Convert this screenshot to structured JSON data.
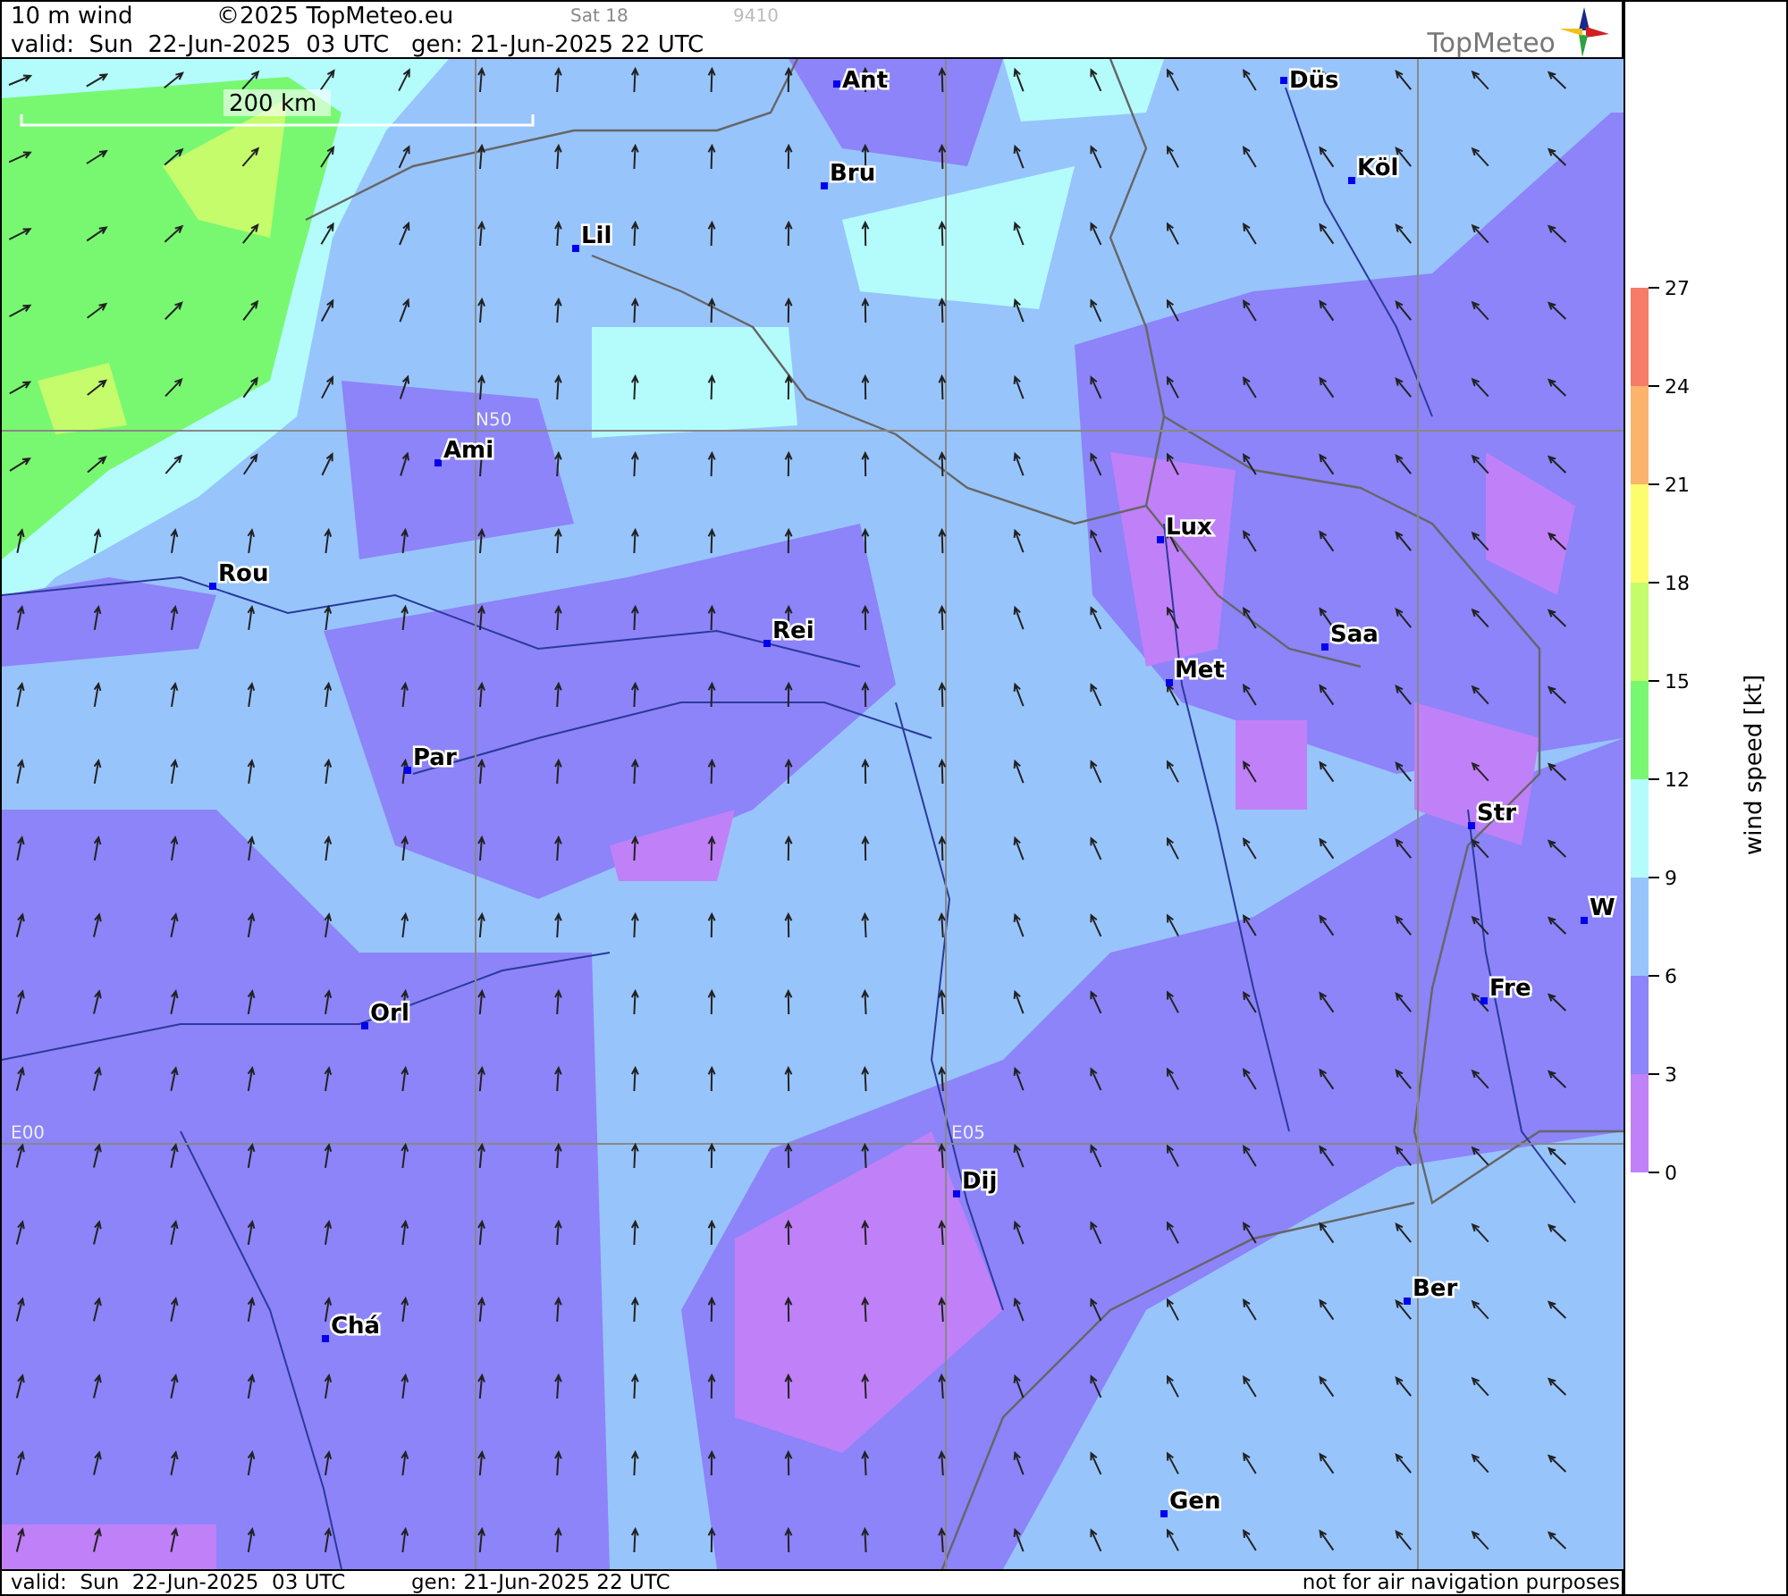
{
  "header": {
    "title": "10 m wind",
    "copyright": "©2025 TopMeteo.eu",
    "satellite": "Sat 18",
    "code": "9410",
    "valid": "valid:  Sun  22-Jun-2025  03 UTC",
    "generated": "gen: 21-Jun-2025 22 UTC",
    "logo": "TopMeteo"
  },
  "map": {
    "scale_label": "200 km",
    "grid_labels": [
      "N50",
      "E00",
      "E05"
    ],
    "cities": [
      {
        "name": "Ant"
      },
      {
        "name": "Düs"
      },
      {
        "name": "Bru"
      },
      {
        "name": "Köl"
      },
      {
        "name": "Lil"
      },
      {
        "name": "Ami"
      },
      {
        "name": "Rou"
      },
      {
        "name": "Rei"
      },
      {
        "name": "Lux"
      },
      {
        "name": "Saa"
      },
      {
        "name": "Met"
      },
      {
        "name": "Par"
      },
      {
        "name": "Str"
      },
      {
        "name": "W"
      },
      {
        "name": "Fre"
      },
      {
        "name": "Orl"
      },
      {
        "name": "Dij"
      },
      {
        "name": "Ber"
      },
      {
        "name": "Chá"
      },
      {
        "name": "Gen"
      }
    ]
  },
  "legend": {
    "title": "wind speed [kt]",
    "ticks": [
      "27",
      "24",
      "21",
      "18",
      "15",
      "12",
      "9",
      "6",
      "3",
      "0"
    ],
    "bands": [
      {
        "color": "#c080f8"
      },
      {
        "color": "#8c84f8"
      },
      {
        "color": "#98c4fc"
      },
      {
        "color": "#b4fcfc"
      },
      {
        "color": "#78f870"
      },
      {
        "color": "#c4fc6c"
      },
      {
        "color": "#fcfc6c"
      },
      {
        "color": "#fcb46c"
      },
      {
        "color": "#f47c68"
      }
    ]
  },
  "footer": {
    "valid": "valid:  Sun  22-Jun-2025  03 UTC",
    "generated": "gen: 21-Jun-2025 22 UTC",
    "disclaimer": "not for air navigation purposes"
  }
}
